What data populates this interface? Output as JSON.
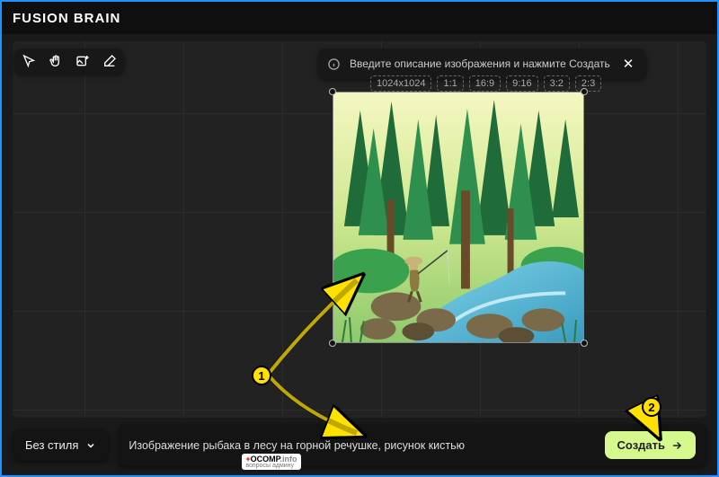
{
  "app": {
    "name": "FUSION BRAIN"
  },
  "hint": {
    "text": "Введите описание изображения и нажмите Создать"
  },
  "sizes": {
    "resolution": "1024x1024",
    "ratios": [
      "1:1",
      "16:9",
      "9:16",
      "3:2",
      "2:3"
    ]
  },
  "style": {
    "label": "Без стиля"
  },
  "prompt": {
    "value": "Изображение рыбака в лесу на горной речушке, рисунок кистью"
  },
  "create": {
    "label": "Создать"
  },
  "watermark": {
    "brand": "OCOMP",
    "tld": ".info",
    "sub": "вопросы админу",
    "plus": "+"
  },
  "annotations": {
    "one": "1",
    "two": "2"
  },
  "tools": {
    "cursor": "cursor-tool",
    "hand": "hand-tool",
    "image": "add-image-tool",
    "eraser": "eraser-tool"
  }
}
